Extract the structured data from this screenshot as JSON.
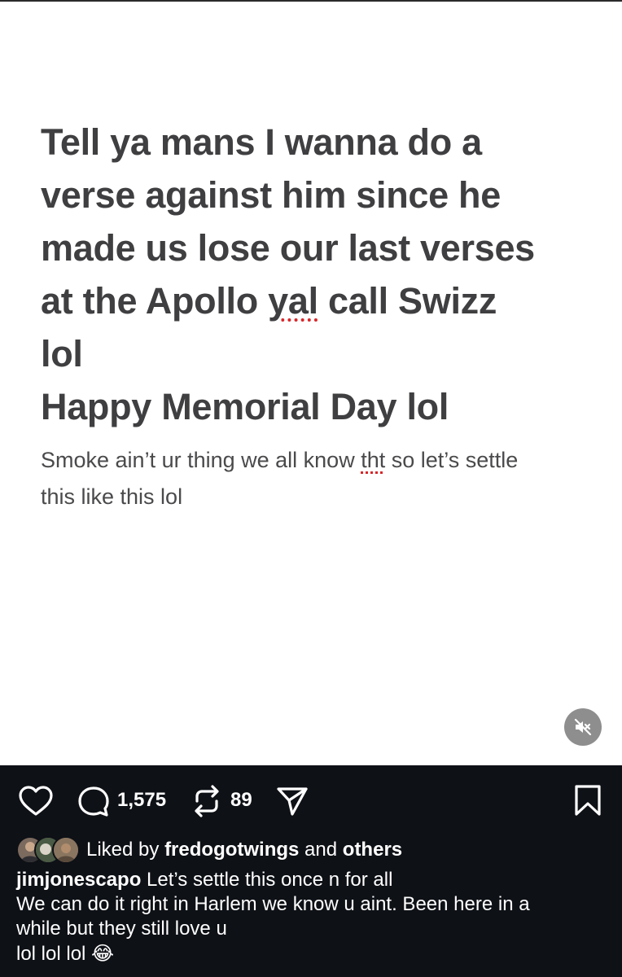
{
  "post": {
    "headline_lines": [
      "Tell ya mans I wanna do a",
      "verse against him since he",
      "made us lose our last verses",
      "at the Apollo ",
      "yal",
      " call Swizz",
      "lol",
      "Happy Memorial Day lol"
    ],
    "subtext_lines": [
      "Smoke ain’t ur thing we all know ",
      "tht",
      " so let’s settle",
      "this like this lol"
    ]
  },
  "actions": {
    "comments_count": "1,575",
    "reposts_count": "89",
    "icons": [
      "heart-icon",
      "comment-icon",
      "repost-icon",
      "share-icon",
      "bookmark-icon",
      "mute-icon"
    ]
  },
  "likes": {
    "prefix": "Liked by ",
    "user": "fredogotwings",
    "middle": " and ",
    "others": "others"
  },
  "caption": {
    "username": "jimjonescapo",
    "line1": " Let’s settle this once n for all",
    "line2": "We can do it right in Harlem we know u aint. Been here in a",
    "line3": "while but they still love u",
    "line4": "lol lol lol ",
    "emoji": "😂"
  },
  "colors": {
    "bar_background": "#0e1116",
    "text_dark": "#3f3f41",
    "spellcheck_red": "#d8272a",
    "mute_button": "#8e8e8e"
  }
}
